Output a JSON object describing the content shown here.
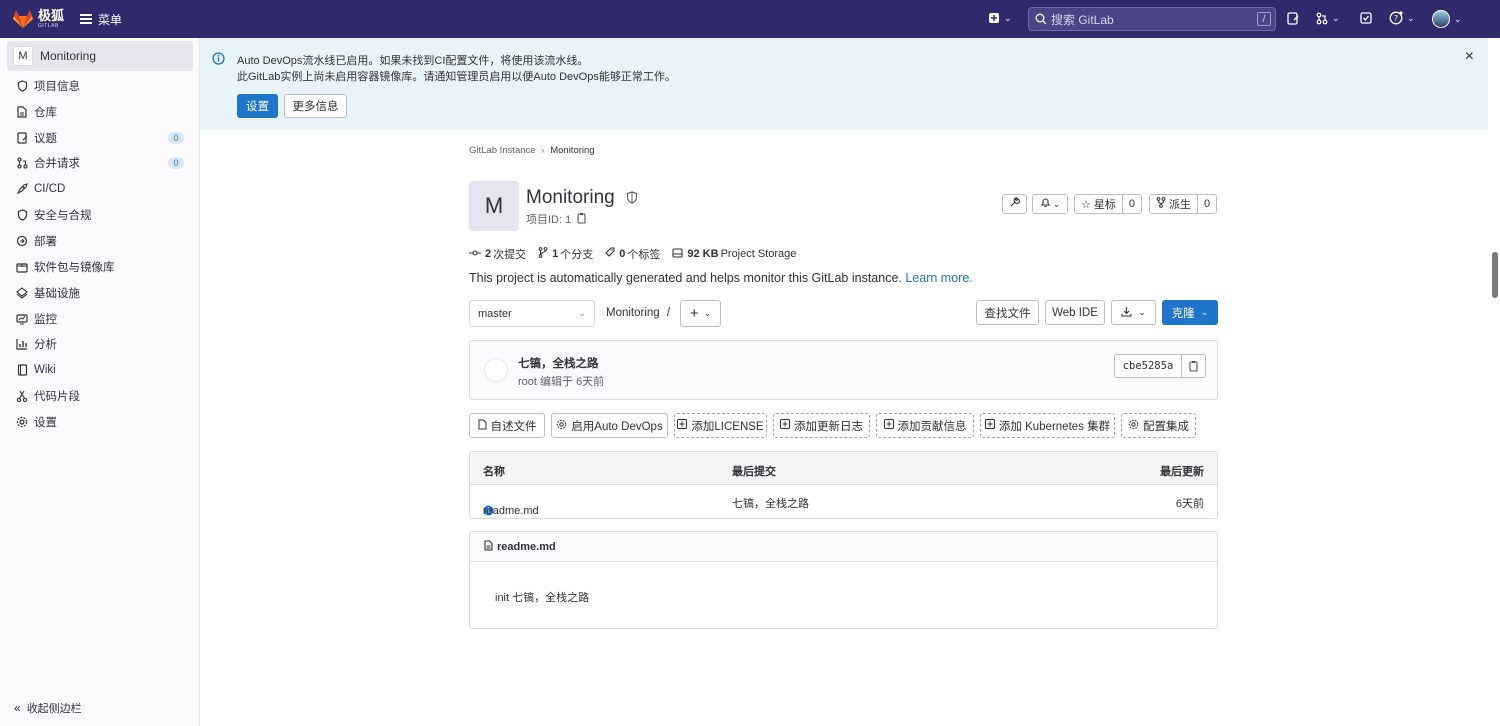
{
  "topbar": {
    "brand": "极狐",
    "brand_sub": "GITLAB",
    "menu_label": "菜单",
    "search_placeholder": "搜索 GitLab",
    "search_shortcut": "/"
  },
  "sidebar": {
    "context": {
      "avatar_letter": "M",
      "name": "Monitoring"
    },
    "items": [
      {
        "label": "项目信息",
        "icon": "info-icon"
      },
      {
        "label": "仓库",
        "icon": "doc-icon"
      },
      {
        "label": "议题",
        "icon": "issues-icon",
        "count": "0"
      },
      {
        "label": "合并请求",
        "icon": "merge-request-icon",
        "count": "0"
      },
      {
        "label": "CI/CD",
        "icon": "rocket-icon"
      },
      {
        "label": "安全与合规",
        "icon": "shield-icon"
      },
      {
        "label": "部署",
        "icon": "deploy-icon"
      },
      {
        "label": "软件包与镜像库",
        "icon": "package-icon"
      },
      {
        "label": "基础设施",
        "icon": "cloud-icon"
      },
      {
        "label": "监控",
        "icon": "monitor-icon"
      },
      {
        "label": "分析",
        "icon": "chart-icon"
      },
      {
        "label": "Wiki",
        "icon": "book-icon"
      },
      {
        "label": "代码片段",
        "icon": "snippet-icon"
      },
      {
        "label": "设置",
        "icon": "gear-icon"
      }
    ],
    "collapse_label": "收起侧边栏"
  },
  "banner": {
    "line1": "Auto DevOps流水线已启用。如果未找到CI配置文件，将使用该流水线。",
    "line2": "此GitLab实例上尚未启用容器镜像库。请通知管理员启用以便Auto DevOps能够正常工作。",
    "settings_label": "设置",
    "more_info_label": "更多信息"
  },
  "breadcrumb": {
    "parent": "GitLab Instance",
    "current": "Monitoring"
  },
  "project": {
    "avatar_letter": "M",
    "title": "Monitoring",
    "id_label": "项目ID: 1",
    "star_label": "星标",
    "star_count": "0",
    "fork_label": "派生",
    "fork_count": "0",
    "stats": {
      "commits_num": "2",
      "commits_label": "次提交",
      "branches_num": "1",
      "branches_label": "个分支",
      "tags_num": "0",
      "tags_label": "个标签",
      "storage_num": "92 KB",
      "storage_label": "Project Storage"
    },
    "description": "This project is automatically generated and helps monitor this GitLab instance.",
    "learn_more": "Learn more."
  },
  "toolbar": {
    "branch": "master",
    "path": "Monitoring",
    "path_sep": "/",
    "find_file": "查找文件",
    "web_ide": "Web IDE",
    "clone": "克隆"
  },
  "commit": {
    "message": "七镐，全栈之路",
    "meta": "root 编辑于 6天前",
    "sha": "cbe5285a"
  },
  "quick_actions": [
    "自述文件",
    "启用Auto DevOps",
    "添加LICENSE",
    "添加更新日志",
    "添加贡献信息",
    "添加 Kubernetes 集群",
    "配置集成"
  ],
  "file_table": {
    "headers": [
      "名称",
      "最后提交",
      "最后更新"
    ],
    "rows": [
      {
        "name": "readme.md",
        "commit": "七镐，全栈之路",
        "updated": "6天前"
      }
    ]
  },
  "readme": {
    "filename": "readme.md",
    "content": "init 七镐，全栈之路"
  },
  "colors": {
    "topbar": "#2f2a6b",
    "primary": "#1f75cb",
    "banner_bg": "#e9f3fc"
  }
}
